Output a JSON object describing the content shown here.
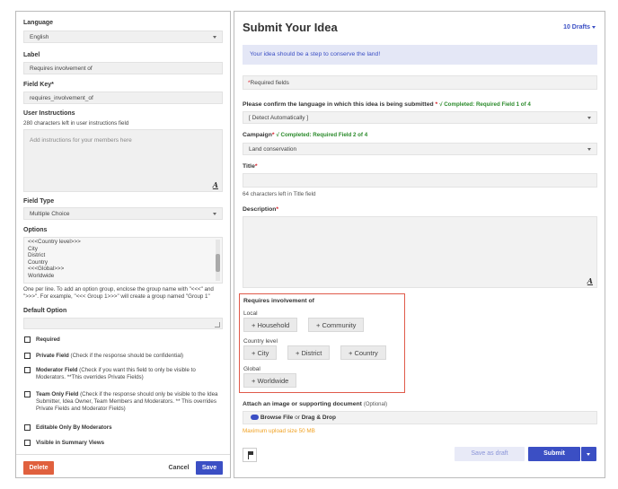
{
  "field_editor": {
    "language_label": "Language",
    "language_value": "English",
    "label_label": "Label",
    "label_value": "Requires involvement of",
    "field_key_label": "Field Key*",
    "field_key_value": "requires_involvement_of",
    "user_instructions_label": "User Instructions",
    "user_instructions_hint": "280 characters left in user instructions field",
    "user_instructions_placeholder": "Add instructions for your members here",
    "field_type_label": "Field Type",
    "field_type_value": "Multiple Choice",
    "options_label": "Options",
    "options_lines": [
      "<<<Country level>>>",
      "City",
      "District",
      "Country",
      "<<<Global>>>",
      "Worldwide"
    ],
    "options_hint_1": "One per line. To add an option group, enclose the group name with \"<<<\" and",
    "options_hint_2": "\">>>\". For example, \"<<< Group 1>>>\" will create a group named \"Group 1\"",
    "default_option_label": "Default Option",
    "checkboxes": [
      {
        "title": "Required",
        "desc": ""
      },
      {
        "title": "Private Field",
        "desc": "(Check if the response should be confidential)"
      },
      {
        "title": "Moderator Field",
        "desc": "(Check if you want this field to only be visible to Moderators. **This overrides Private Fields)"
      },
      {
        "title": "Team Only Field",
        "desc": "(Check if the response should only be visible to the Idea Submitter, Idea Owner, Team Members and Moderators. ** This overrides Private Fields and Moderator Fields)"
      },
      {
        "title": "Editable Only By Moderators",
        "desc": ""
      },
      {
        "title": "Visible in Summary Views",
        "desc": ""
      }
    ],
    "delete_label": "Delete",
    "cancel_label": "Cancel",
    "save_label": "Save"
  },
  "submit_form": {
    "title": "Submit Your Idea",
    "drafts_label": "10 Drafts",
    "banner_text": "Your idea should be a step to conserve the land!",
    "required_note": "Required fields",
    "language_question": "Please confirm the language in which this idea is being submitted",
    "language_status": "Completed: Required Field 1 of 4",
    "language_value": "[ Detect Automatically ]",
    "campaign_label": "Campaign",
    "campaign_status": "Completed: Required Field 2 of 4",
    "campaign_value": "Land conservation",
    "title_label": "Title",
    "title_hint": "64 characters left in Title field",
    "description_label": "Description",
    "involvement_label": "Requires involvement of",
    "groups": [
      {
        "name": "Local",
        "chips": [
          "Household",
          "Community"
        ]
      },
      {
        "name": "Country level",
        "chips": [
          "City",
          "District",
          "Country"
        ]
      },
      {
        "name": "Global",
        "chips": [
          "Worldwide"
        ]
      }
    ],
    "attach_label": "Attach an image or supporting document",
    "attach_optional": "(Optional)",
    "browse_label": "Browse File",
    "or_label": "or",
    "drag_label": "Drag & Drop",
    "upload_note": "Maximum upload size 50 MB",
    "save_draft_label": "Save as draft",
    "submit_label": "Submit"
  },
  "colors": {
    "accent": "#3b4fc4",
    "delete": "#e0603e",
    "required": "#d6202a",
    "ok": "#2a8a2a",
    "highlight": "#e05a4a",
    "upload_note": "#f0a020"
  }
}
